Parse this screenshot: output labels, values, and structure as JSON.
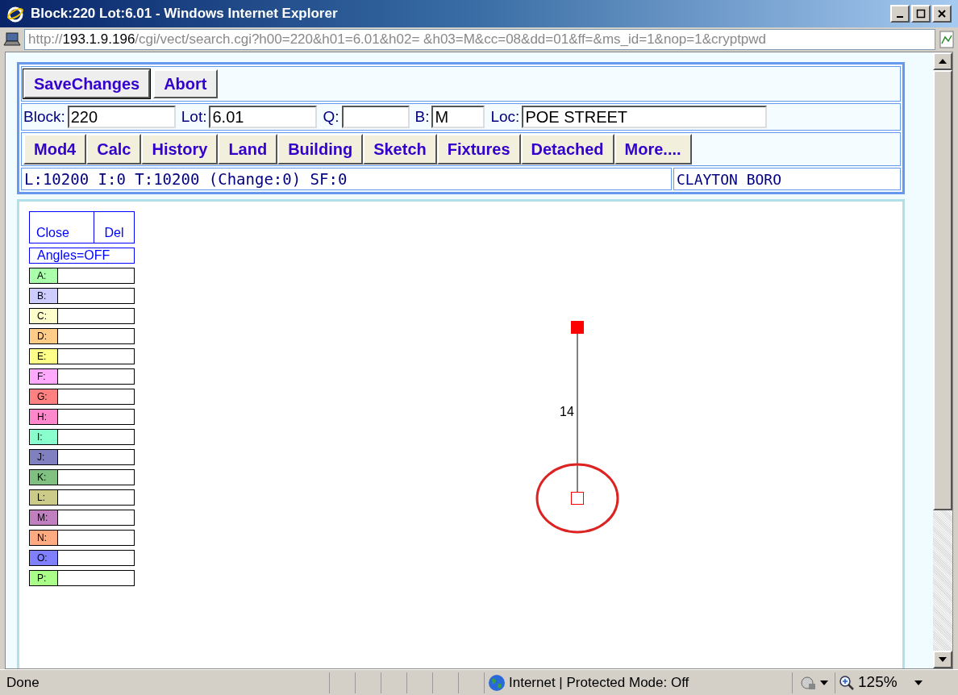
{
  "window": {
    "title": "Block:220 Lot:6.01 - Windows Internet Explorer"
  },
  "address": {
    "prefix": "http://",
    "host": "193.1.9.196",
    "path": "/cgi/vect/search.cgi?h00=220&h01=6.01&h02= &h03=M&cc=08&dd=01&ff=&ms_id=1&nop=1&cryptpwd"
  },
  "actions": [
    "SaveChanges",
    "Abort"
  ],
  "fields": [
    {
      "label": "Block:",
      "value": "220"
    },
    {
      "label": "Lot:",
      "value": "6.01"
    },
    {
      "label": "Q:"
    },
    {
      "label": "B:",
      "value": "M"
    },
    {
      "label": "Loc:",
      "value": "POE STREET"
    }
  ],
  "nav": [
    "Mod4",
    "Calc",
    "History",
    "Land",
    "Building",
    "Sketch",
    "Fixtures",
    "Detached",
    "More...."
  ],
  "summary": {
    "values": "L:10200 I:0 T:10200 (Change:0) SF:0",
    "municipality": "CLAYTON BORO"
  },
  "sketch_tools": {
    "close": "Close",
    "delete": "Del",
    "angles": "Angles=OFF"
  },
  "layers": [
    {
      "label": "A:",
      "color": "#aaffaa"
    },
    {
      "label": "B:",
      "color": "#ccccff"
    },
    {
      "label": "C:",
      "color": "#ffffcc"
    },
    {
      "label": "D:",
      "color": "#ffcc88"
    },
    {
      "label": "E:",
      "color": "#ffff88"
    },
    {
      "label": "F:",
      "color": "#ffaaff"
    },
    {
      "label": "G:",
      "color": "#ff8080"
    },
    {
      "label": "H:",
      "color": "#ff88cc"
    },
    {
      "label": "I:",
      "color": "#88ffcc"
    },
    {
      "label": "J:",
      "color": "#8080c0"
    },
    {
      "label": "K:",
      "color": "#80c080"
    },
    {
      "label": "L:",
      "color": "#cccc88"
    },
    {
      "label": "M:",
      "color": "#c080c0"
    },
    {
      "label": "N:",
      "color": "#ffaa80"
    },
    {
      "label": "O:",
      "color": "#8080ff"
    },
    {
      "label": "P:",
      "color": "#aaff88"
    }
  ],
  "canvas": {
    "segment_label": "14"
  },
  "status_bar": {
    "text": "Done",
    "zone": "Internet | Protected Mode: Off",
    "zoom": "125%"
  }
}
